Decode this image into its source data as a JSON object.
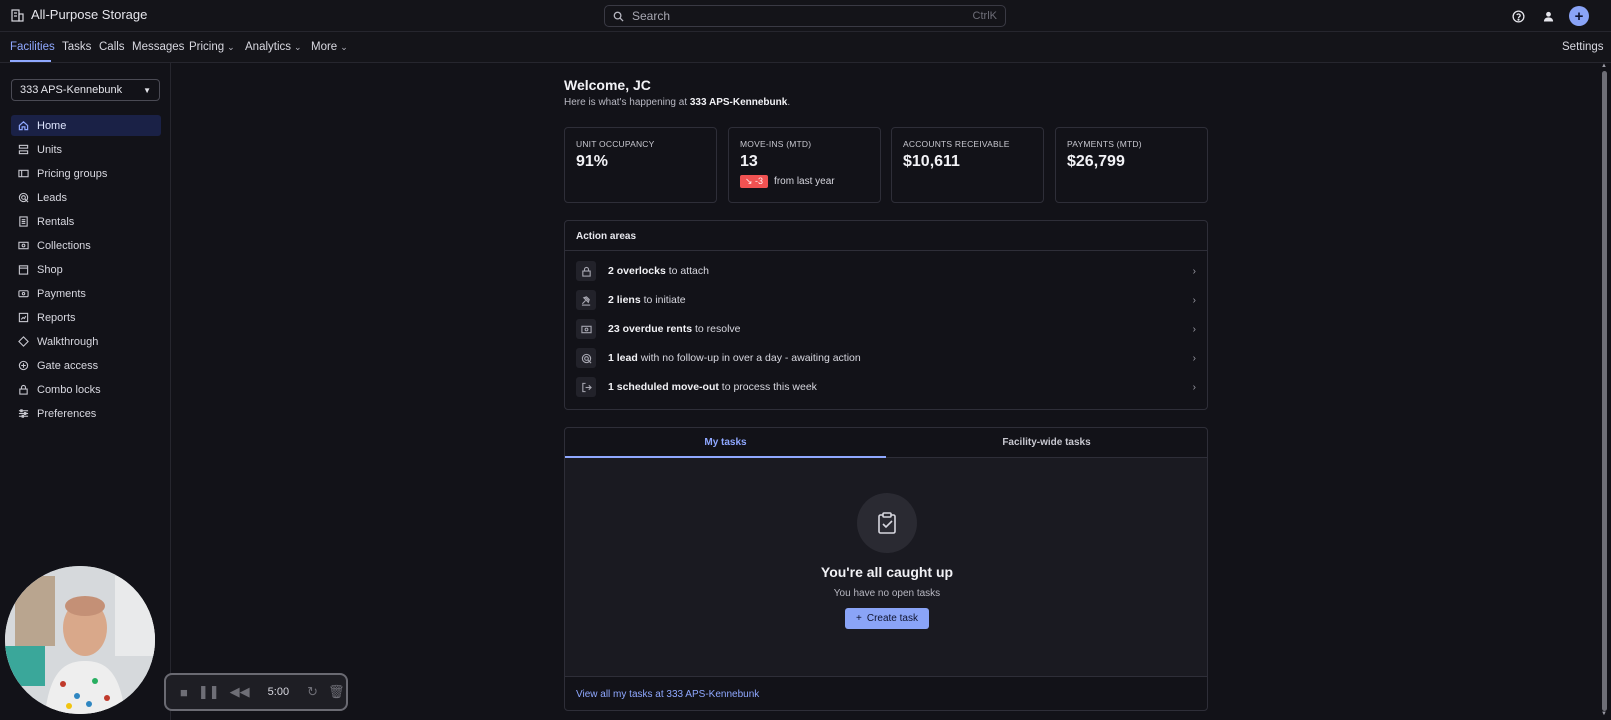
{
  "app": {
    "title": "All-Purpose Storage"
  },
  "search": {
    "placeholder": "Search",
    "shortcut": "CtrlK"
  },
  "top_icons": [
    "help-circle-icon",
    "user-icon",
    "plus-circle-icon"
  ],
  "nav": {
    "items": [
      {
        "label": "Facilities",
        "active": true,
        "dropdown": false
      },
      {
        "label": "Tasks",
        "active": false,
        "dropdown": false
      },
      {
        "label": "Calls",
        "active": false,
        "dropdown": false
      },
      {
        "label": "Messages",
        "active": false,
        "dropdown": false
      },
      {
        "label": "Pricing",
        "active": false,
        "dropdown": true
      },
      {
        "label": "Analytics",
        "active": false,
        "dropdown": true
      },
      {
        "label": "More",
        "active": false,
        "dropdown": true
      }
    ],
    "settings_label": "Settings"
  },
  "sidebar": {
    "facility": "333 APS-Kennebunk",
    "items": [
      {
        "label": "Home",
        "icon": "home-icon",
        "active": true
      },
      {
        "label": "Units",
        "icon": "stack-icon",
        "active": false
      },
      {
        "label": "Pricing groups",
        "icon": "price-tag-icon",
        "active": false
      },
      {
        "label": "Leads",
        "icon": "target-icon",
        "active": false
      },
      {
        "label": "Rentals",
        "icon": "document-icon",
        "active": false
      },
      {
        "label": "Collections",
        "icon": "cash-icon",
        "active": false
      },
      {
        "label": "Shop",
        "icon": "storefront-icon",
        "active": false
      },
      {
        "label": "Payments",
        "icon": "payments-icon",
        "active": false
      },
      {
        "label": "Reports",
        "icon": "report-icon",
        "active": false
      },
      {
        "label": "Walkthrough",
        "icon": "diamond-icon",
        "active": false
      },
      {
        "label": "Gate access",
        "icon": "gate-icon",
        "active": false
      },
      {
        "label": "Combo locks",
        "icon": "lock-icon",
        "active": false
      },
      {
        "label": "Preferences",
        "icon": "sliders-icon",
        "active": false
      }
    ]
  },
  "main": {
    "welcome": "Welcome, JC",
    "sub_prefix": "Here is what's happening at ",
    "sub_facility": "333 APS-Kennebunk",
    "sub_suffix": ".",
    "stats": [
      {
        "label": "UNIT OCCUPANCY",
        "value": "91%"
      },
      {
        "label": "MOVE-INS (MTD)",
        "value": "13",
        "trend_badge": "↘ -3",
        "trend_text": "from last year"
      },
      {
        "label": "ACCOUNTS RECEIVABLE",
        "value": "$10,611"
      },
      {
        "label": "PAYMENTS (MTD)",
        "value": "$26,799"
      }
    ],
    "action_areas": {
      "title": "Action areas",
      "rows": [
        {
          "icon": "lock-icon",
          "bold": "2 overlocks",
          "rest": " to attach"
        },
        {
          "icon": "gavel-icon",
          "bold": "2 liens",
          "rest": " to initiate"
        },
        {
          "icon": "cash-icon",
          "bold": "23 overdue rents",
          "rest": " to resolve"
        },
        {
          "icon": "target-icon",
          "bold": "1 lead",
          "rest": " with no follow-up in over a day - awaiting action"
        },
        {
          "icon": "exit-icon",
          "bold": "1 scheduled move-out",
          "rest": " to process this week"
        }
      ]
    },
    "tasks": {
      "tabs": [
        "My tasks",
        "Facility-wide tasks"
      ],
      "empty_title": "You're all caught up",
      "empty_sub": "You have no open tasks",
      "create_label": "Create task",
      "footer_link": "View all my tasks at 333 APS-Kennebunk"
    }
  },
  "recorder": {
    "time": "5:00"
  },
  "colors": {
    "accent": "#8fa8ff",
    "background": "#121218",
    "danger": "#f05252",
    "active_nav_bg": "#1a2146"
  }
}
